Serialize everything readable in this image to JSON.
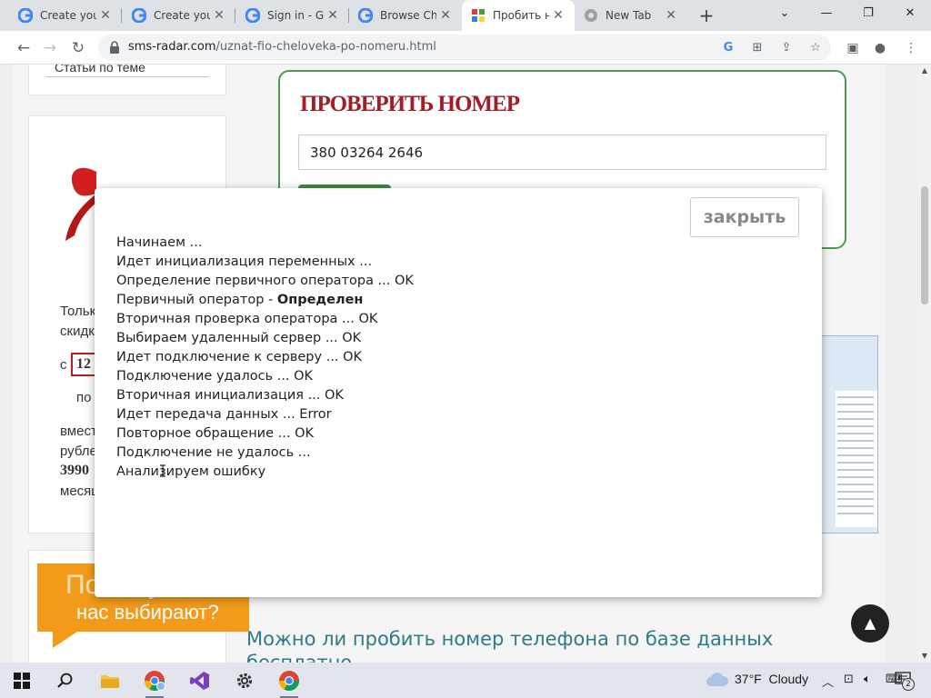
{
  "browser": {
    "tabs": [
      {
        "title": "Create your",
        "favicon": "google-icon",
        "active": false
      },
      {
        "title": "Create your",
        "favicon": "google-icon",
        "active": false
      },
      {
        "title": "Sign in - Go",
        "favicon": "google-icon",
        "active": false
      },
      {
        "title": "Browse Chr",
        "favicon": "google-icon",
        "active": false
      },
      {
        "title": "Пробить н",
        "favicon": "site-favicon",
        "active": true
      },
      {
        "title": "New Tab",
        "favicon": "chrome-icon",
        "active": false
      }
    ],
    "url_host": "sms-radar.com",
    "url_path": "/uznat-fio-cheloveka-po-nomeru.html"
  },
  "sidebar": {
    "related_link": "Статьи по теме",
    "promo": {
      "line1": "Толькo",
      "line2": "скидк",
      "prefix": "с",
      "boxed_value": "12",
      "line4": "по",
      "line5": "вмест",
      "line6": "рубле",
      "price": "3990",
      "line8": "месяц"
    },
    "why_banner": {
      "line1": "Почему",
      "line2": "нас выбирают?"
    }
  },
  "check_form": {
    "title": "ПРОВЕРИТЬ НОМЕР",
    "phone_value": "380 03264 2646"
  },
  "modal": {
    "close_label": "закрыть",
    "log_lines": [
      "Начинаем ...",
      "Идет инициализация переменных ...",
      "Определение первичного оператора ... OK",
      "Первичный оператор - ",
      "Вторичная проверка оператора ... OK",
      "Выбираем удаленный сервер ... OK",
      "Идет подключение к серверу ... OK",
      "Подключение удалось ... OK",
      "Вторичная инициализация ... OK",
      "Идет передача данных ... Error",
      "Повторное обращение ... OK",
      "Подключение не удалось ...",
      "Анализируем ошибку"
    ],
    "operator_status": "Определен"
  },
  "page_heading": "Можно ли пробить номер телефона по базе данных бесплатно",
  "taskbar": {
    "weather_temp": "37°F",
    "weather_desc": "Cloudy",
    "notification_count": "2"
  }
}
